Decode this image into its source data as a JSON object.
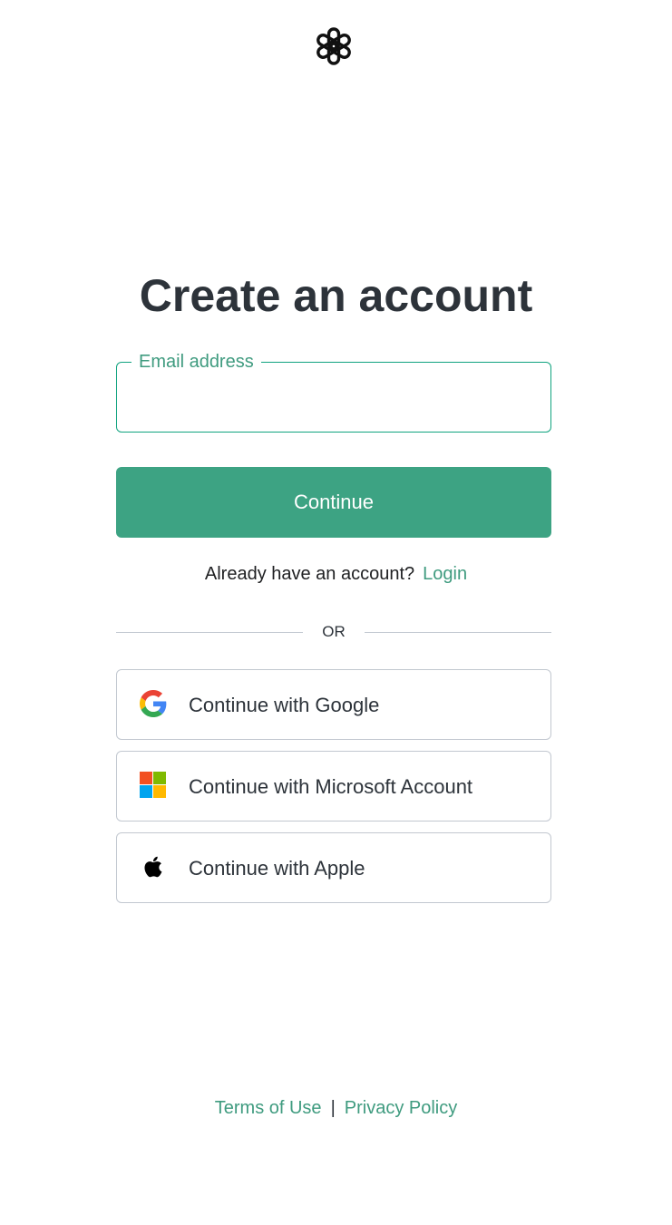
{
  "logo": {
    "icon": "openai-logo-icon"
  },
  "header": {
    "title": "Create an account"
  },
  "form": {
    "email_label": "Email address",
    "email_value": "",
    "email_placeholder": "",
    "continue_label": "Continue"
  },
  "login_prompt": {
    "question": "Already have an account?",
    "link_label": "Login"
  },
  "divider": {
    "label": "OR"
  },
  "social": [
    {
      "label": "Continue with Google",
      "icon": "google-icon"
    },
    {
      "label": "Continue with Microsoft Account",
      "icon": "microsoft-icon"
    },
    {
      "label": "Continue with Apple",
      "icon": "apple-icon"
    }
  ],
  "footer": {
    "terms_label": "Terms of Use",
    "separator": "|",
    "privacy_label": "Privacy Policy"
  },
  "colors": {
    "accent": "#3da383",
    "accent_text": "#3f9b7f",
    "text": "#2d333a",
    "border": "#c2c8d0"
  }
}
